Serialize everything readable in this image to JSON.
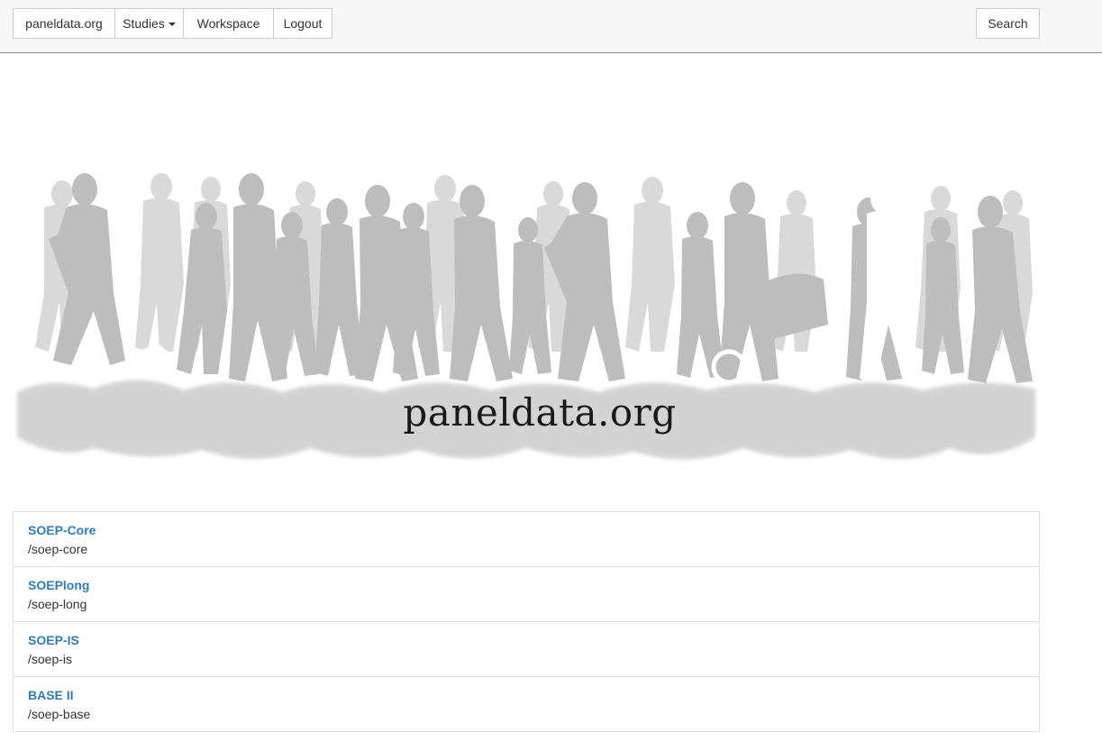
{
  "navbar": {
    "brand_label": "paneldata.org",
    "studies_label": "Studies",
    "workspace_label": "Workspace",
    "logout_label": "Logout",
    "search_label": "Search"
  },
  "banner": {
    "title": "paneldata.org"
  },
  "studies": [
    {
      "name": "SOEP-Core",
      "path": "/soep-core"
    },
    {
      "name": "SOEPlong",
      "path": "/soep-long"
    },
    {
      "name": "SOEP-IS",
      "path": "/soep-is"
    },
    {
      "name": "BASE II",
      "path": "/soep-base"
    }
  ],
  "colors": {
    "link": "#337ab7",
    "silhouette_front": "#bdbdbd",
    "silhouette_back": "#d9d9d9"
  }
}
